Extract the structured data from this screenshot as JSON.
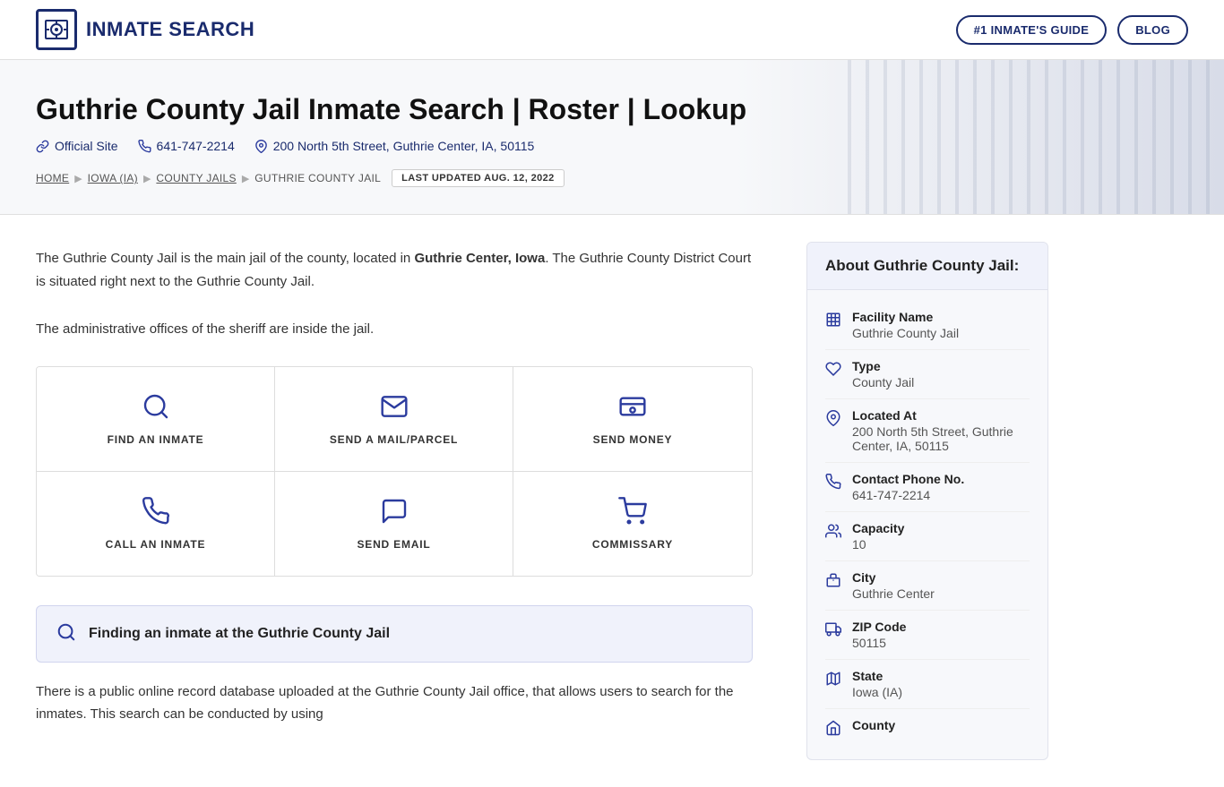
{
  "nav": {
    "brand_title": "INMATE SEARCH",
    "btn_guide": "#1 INMATE'S GUIDE",
    "btn_blog": "BLOG"
  },
  "hero": {
    "title": "Guthrie County Jail Inmate Search | Roster | Lookup",
    "official_site": "Official Site",
    "phone": "641-747-2214",
    "address": "200 North 5th Street, Guthrie Center, IA, 50115",
    "breadcrumb": [
      {
        "label": "HOME",
        "href": "#"
      },
      {
        "label": "IOWA (IA)",
        "href": "#"
      },
      {
        "label": "COUNTY JAILS",
        "href": "#"
      },
      {
        "label": "GUTHRIE COUNTY JAIL",
        "href": "#"
      }
    ],
    "last_updated": "LAST UPDATED AUG. 12, 2022"
  },
  "content": {
    "para1": "The Guthrie County Jail is the main jail of the county, located in ",
    "para1_bold": "Guthrie Center, Iowa",
    "para1_end": ". The Guthrie County District Court is situated right next to the Guthrie County Jail.",
    "para2": "The administrative offices of the sheriff are inside the jail.",
    "actions": [
      {
        "id": "find-inmate",
        "label": "FIND AN INMATE",
        "icon": "search"
      },
      {
        "id": "send-mail",
        "label": "SEND A MAIL/PARCEL",
        "icon": "mail"
      },
      {
        "id": "send-money",
        "label": "SEND MONEY",
        "icon": "money"
      },
      {
        "id": "call-inmate",
        "label": "CALL AN INMATE",
        "icon": "phone"
      },
      {
        "id": "send-email",
        "label": "SEND EMAIL",
        "icon": "email"
      },
      {
        "id": "commissary",
        "label": "COMMISSARY",
        "icon": "cart"
      }
    ],
    "finding_title": "Finding an inmate at the Guthrie County Jail",
    "bottom_text": "There is a public online record database uploaded at the Guthrie County Jail office, that allows users to search for the inmates. This search can be conducted by using"
  },
  "sidebar": {
    "header": "About Guthrie County Jail:",
    "items": [
      {
        "icon": "facility",
        "label": "Facility Name",
        "value": "Guthrie County Jail"
      },
      {
        "icon": "type",
        "label": "Type",
        "value": "County Jail"
      },
      {
        "icon": "location",
        "label": "Located At",
        "value": "200 North 5th Street, Guthrie Center, IA, 50115"
      },
      {
        "icon": "phone",
        "label": "Contact Phone No.",
        "value": "641-747-2214"
      },
      {
        "icon": "capacity",
        "label": "Capacity",
        "value": "10"
      },
      {
        "icon": "city",
        "label": "City",
        "value": "Guthrie Center"
      },
      {
        "icon": "zip",
        "label": "ZIP Code",
        "value": "50115"
      },
      {
        "icon": "state",
        "label": "State",
        "value": "Iowa (IA)"
      },
      {
        "icon": "county",
        "label": "County",
        "value": ""
      }
    ]
  }
}
